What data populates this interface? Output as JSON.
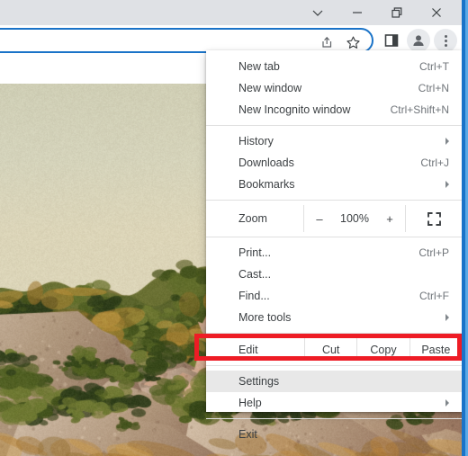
{
  "window": {
    "titlebar_buttons": [
      {
        "name": "chevron-down-icon",
        "label": "⌄"
      },
      {
        "name": "minimize-icon",
        "label": "–"
      },
      {
        "name": "restore-icon",
        "label": "❐"
      },
      {
        "name": "close-icon",
        "label": "✕"
      }
    ]
  },
  "toolbar": {
    "address_value": "",
    "address_placeholder": "",
    "omnibox_icons": [
      "share-icon",
      "bookmark-star-icon"
    ],
    "trailing_icons": [
      "side-panel-icon",
      "profile-avatar-icon",
      "three-dot-menu-icon"
    ]
  },
  "menu": {
    "groups": [
      {
        "items": [
          {
            "label": "New tab",
            "accel": "Ctrl+T",
            "submenu": false,
            "name": "menu-item-new-tab"
          },
          {
            "label": "New window",
            "accel": "Ctrl+N",
            "submenu": false,
            "name": "menu-item-new-window"
          },
          {
            "label": "New Incognito window",
            "accel": "Ctrl+Shift+N",
            "submenu": false,
            "name": "menu-item-new-incognito-window"
          }
        ]
      },
      {
        "items": [
          {
            "label": "History",
            "accel": "",
            "submenu": true,
            "name": "menu-item-history"
          },
          {
            "label": "Downloads",
            "accel": "Ctrl+J",
            "submenu": false,
            "name": "menu-item-downloads"
          },
          {
            "label": "Bookmarks",
            "accel": "",
            "submenu": true,
            "name": "menu-item-bookmarks"
          }
        ]
      }
    ],
    "zoom_row": {
      "label": "Zoom",
      "minus": "–",
      "percent": "100%",
      "plus": "+",
      "fullscreen_icon": "fullscreen-icon"
    },
    "group3": [
      {
        "label": "Print...",
        "accel": "Ctrl+P",
        "submenu": false,
        "name": "menu-item-print"
      },
      {
        "label": "Cast...",
        "accel": "",
        "submenu": false,
        "name": "menu-item-cast"
      },
      {
        "label": "Find...",
        "accel": "Ctrl+F",
        "submenu": false,
        "name": "menu-item-find"
      },
      {
        "label": "More tools",
        "accel": "",
        "submenu": true,
        "name": "menu-item-more-tools"
      }
    ],
    "edit_row": {
      "label": "Edit",
      "cut": "Cut",
      "copy": "Copy",
      "paste": "Paste"
    },
    "group4": [
      {
        "label": "Settings",
        "accel": "",
        "submenu": false,
        "highlight": true,
        "name": "menu-item-settings"
      },
      {
        "label": "Help",
        "accel": "",
        "submenu": true,
        "highlight": false,
        "name": "menu-item-help"
      }
    ],
    "group5": [
      {
        "label": "Exit",
        "accel": "",
        "submenu": false,
        "name": "menu-item-exit"
      }
    ]
  },
  "annotation": {
    "target": "Settings",
    "color": "#ee1c25"
  },
  "page_content": {
    "description": "landscape photograph of pink granite rocks and green shrubs at sunset under a pale sky"
  },
  "colors": {
    "accent_blue": "#1a73c8",
    "titlebar": "#dfe1e5",
    "menu_bg": "#ffffff",
    "highlight": "#e8e8e8",
    "annotation_red": "#ee1c25"
  }
}
